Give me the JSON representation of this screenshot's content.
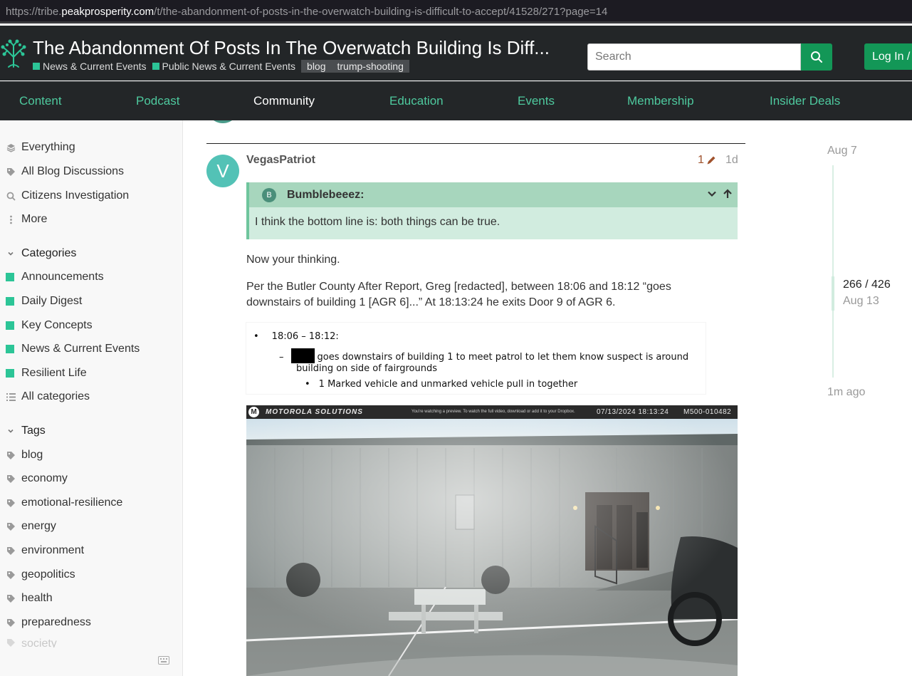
{
  "browser": {
    "url_prefix": "https://tribe.",
    "url_host": "peakprosperity.com",
    "url_path": "/t/the-abandonment-of-posts-in-the-overwatch-building-is-difficult-to-accept/41528/271?page=14"
  },
  "header": {
    "title": "The Abandonment Of Posts In The Overwatch Building Is Diff...",
    "category": "News & Current Events",
    "subcategory": "Public News & Current Events",
    "tags": [
      "blog",
      "trump-shooting"
    ],
    "search_placeholder": "Search",
    "login_label": "Log In /"
  },
  "nav": {
    "items": [
      "Content",
      "Podcast",
      "Community",
      "Education",
      "Events",
      "Membership",
      "Insider Deals"
    ],
    "active": "Community"
  },
  "sidebar": {
    "top_links": [
      {
        "label": "Everything",
        "icon": "layers-icon"
      },
      {
        "label": "All Blog Discussions",
        "icon": "tag-icon"
      },
      {
        "label": "Citizens Investigation",
        "icon": "search-icon"
      },
      {
        "label": "More",
        "icon": "vertical-ellipsis-icon"
      }
    ],
    "categories_heading": "Categories",
    "categories": [
      "Announcements",
      "Daily Digest",
      "Key Concepts",
      "News & Current Events",
      "Resilient Life"
    ],
    "all_categories": "All categories",
    "tags_heading": "Tags",
    "tags": [
      "blog",
      "economy",
      "emotional-resilience",
      "energy",
      "environment",
      "geopolitics",
      "health",
      "preparedness",
      "society"
    ]
  },
  "post": {
    "author_initial": "V",
    "author": "VegasPatriot",
    "edit_count": "1",
    "age": "1d",
    "quote_author_initial": "B",
    "quote_author": "Bumblebeeez:",
    "quote_text": "I think the bottom line is: both things can be true.",
    "paragraph1": "Now your thinking.",
    "paragraph2_line1": "Per the Butler County After Report, Greg [redacted], between 18:06 and 18:12 “goes",
    "paragraph2_line2": "downstairs of building 1 [AGR 6]...” At 18:13:24 he exits Door 9 of AGR 6.",
    "document": {
      "bullet": "•",
      "time_range": "18:06 – 18:12:",
      "dash": "–",
      "line2": "goes downstairs of building 1 to meet patrol to let them know suspect is around",
      "line3": "building on side of fairgrounds",
      "line4": "1 Marked vehicle and unmarked vehicle pull in together"
    },
    "camera": {
      "logo": "M",
      "brand": "MOTOROLA SOLUTIONS",
      "note": "You're watching a preview. To watch the full video, download or add it to your Dropbox.",
      "timestamp": "07/13/2024  18:13:24",
      "device_id": "M500-010482"
    }
  },
  "timeline": {
    "start_date": "Aug 7",
    "position": "266 / 426",
    "position_date": "Aug 13",
    "end_label": "1m ago"
  },
  "colors": {
    "accent_green": "#139757",
    "category_green": "#2cc597",
    "quote_header": "#a7d6bd",
    "quote_body": "#d1ecdf",
    "header_bg": "#232628"
  }
}
